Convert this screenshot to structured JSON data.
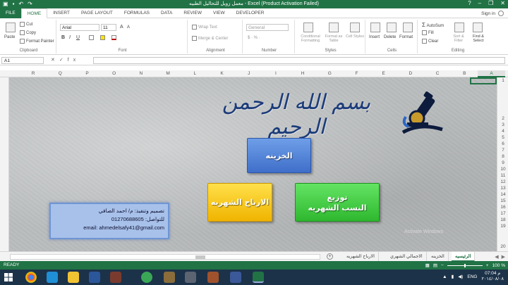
{
  "window": {
    "title": "معمل زويل للتحاليل الطبيه - Excel (Product Activation Failed)",
    "sign_in": "Sign in"
  },
  "ribbon_tabs": [
    "FILE",
    "HOME",
    "INSERT",
    "PAGE LAYOUT",
    "FORMULAS",
    "DATA",
    "REVIEW",
    "VIEW",
    "DEVELOPER"
  ],
  "ribbon": {
    "clipboard": {
      "paste": "Paste",
      "cut": "Cut",
      "copy": "Copy",
      "format_painter": "Format Painter",
      "label": "Clipboard"
    },
    "font": {
      "name": "Arial",
      "size": "11",
      "bold": "B",
      "italic": "I",
      "underline": "U",
      "grow": "A",
      "shrink": "A",
      "label": "Font"
    },
    "alignment": {
      "wrap_text": "Wrap Text",
      "merge_center": "Merge & Center",
      "label": "Alignment"
    },
    "number": {
      "format": "General",
      "label": "Number"
    },
    "styles": {
      "conditional": "Conditional Formatting",
      "format_as_table": "Format as Table",
      "cell_styles": "Cell Styles",
      "label": "Styles"
    },
    "cells": {
      "insert": "Insert",
      "delete": "Delete",
      "format": "Format",
      "label": "Cells"
    },
    "editing": {
      "autosum": "AutoSum",
      "fill": "Fill",
      "clear": "Clear",
      "sort_filter": "Sort & Filter",
      "find_select": "Find & Select",
      "label": "Editing"
    }
  },
  "formula_bar": {
    "name_box": "A1",
    "fx": "fx",
    "value": ""
  },
  "columns": [
    "R",
    "Q",
    "P",
    "O",
    "N",
    "M",
    "L",
    "K",
    "J",
    "I",
    "H",
    "G",
    "F",
    "E",
    "D",
    "C",
    "B",
    "A"
  ],
  "rows": [
    "1",
    "2",
    "3",
    "4",
    "5",
    "6",
    "7",
    "8",
    "9",
    "10",
    "11",
    "12",
    "13",
    "14",
    "15",
    "16",
    "17",
    "18",
    "19",
    "20"
  ],
  "sheet": {
    "bismillah": "بسم الله الرحمن الرحيم",
    "btn_treasury": "الخزينه",
    "btn_profits": "الارباح الشهريه",
    "btn_dist_line1": "توزيع",
    "btn_dist_line2": "النسب الشهريه",
    "credit_line1": "تصميم وتنفيذ: م/ احمد الصافي",
    "credit_line2": "للتواصل: 01270688605",
    "credit_line3": "email: ahmedelsafy41@gmail.com",
    "watermark": "Activate Windows"
  },
  "sheet_tabs": [
    "الرئيسيه",
    "الخزينه",
    "الاجمالي الشهري",
    "الارباح الشهريه"
  ],
  "add_sheet": "+",
  "status": {
    "ready": "READY",
    "zoom": "100 %"
  },
  "taskbar": {
    "lang": "ENG",
    "time": "07:04 م",
    "date": "٢٠١٤/٠٨/٠٨"
  },
  "colors": {
    "excel_green": "#217346",
    "taskbar": "#1c3249"
  }
}
